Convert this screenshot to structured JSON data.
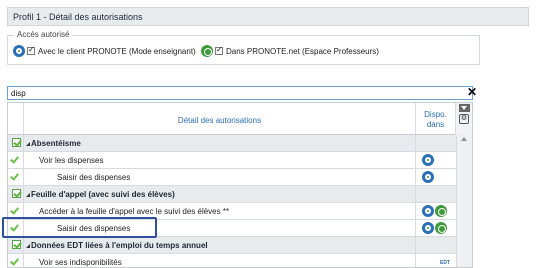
{
  "title": "Profil 1 - Détail des autorisations",
  "access": {
    "legend": "Accès autorisé",
    "client_label": "Avec le client PRONOTE (Mode enseignant)",
    "net_label": "Dans PRONOTE.net (Espace Professeurs)"
  },
  "search": {
    "value": "disp",
    "clear_symbol": "✕"
  },
  "grid": {
    "header_detail": "Détail des autorisations",
    "header_dispo_1": "Dispo.",
    "header_dispo_2": "dans",
    "settings_symbol": "⚙"
  },
  "rows": [
    {
      "kind": "cat",
      "label": "Absentéisme",
      "icons": []
    },
    {
      "kind": "item",
      "label": "Voir les dispenses",
      "icons": [
        "client-icon"
      ]
    },
    {
      "kind": "sub",
      "label": "Saisir des dispenses",
      "icons": [
        "client-icon"
      ]
    },
    {
      "kind": "cat",
      "label": "Feuille d'appel (avec suivi des élèves)",
      "icons": []
    },
    {
      "kind": "item",
      "label": "Accéder à la feuille d'appel avec le suivi des élèves **",
      "icons": [
        "client-icon",
        "net-icon"
      ]
    },
    {
      "kind": "sub",
      "label": "Saisir des dispenses",
      "icons": [
        "client-icon",
        "net-icon"
      ]
    },
    {
      "kind": "cat",
      "label": "Données EDT liées à l'emploi du temps annuel",
      "icons": []
    },
    {
      "kind": "item",
      "label": "Voir ses indisponibilités",
      "icons": [
        "edt-icon"
      ],
      "tag": "EDT"
    }
  ],
  "colors": {
    "accent": "#2a6fb6",
    "check": "#6cc04a",
    "highlight": "#2f4fa0"
  }
}
